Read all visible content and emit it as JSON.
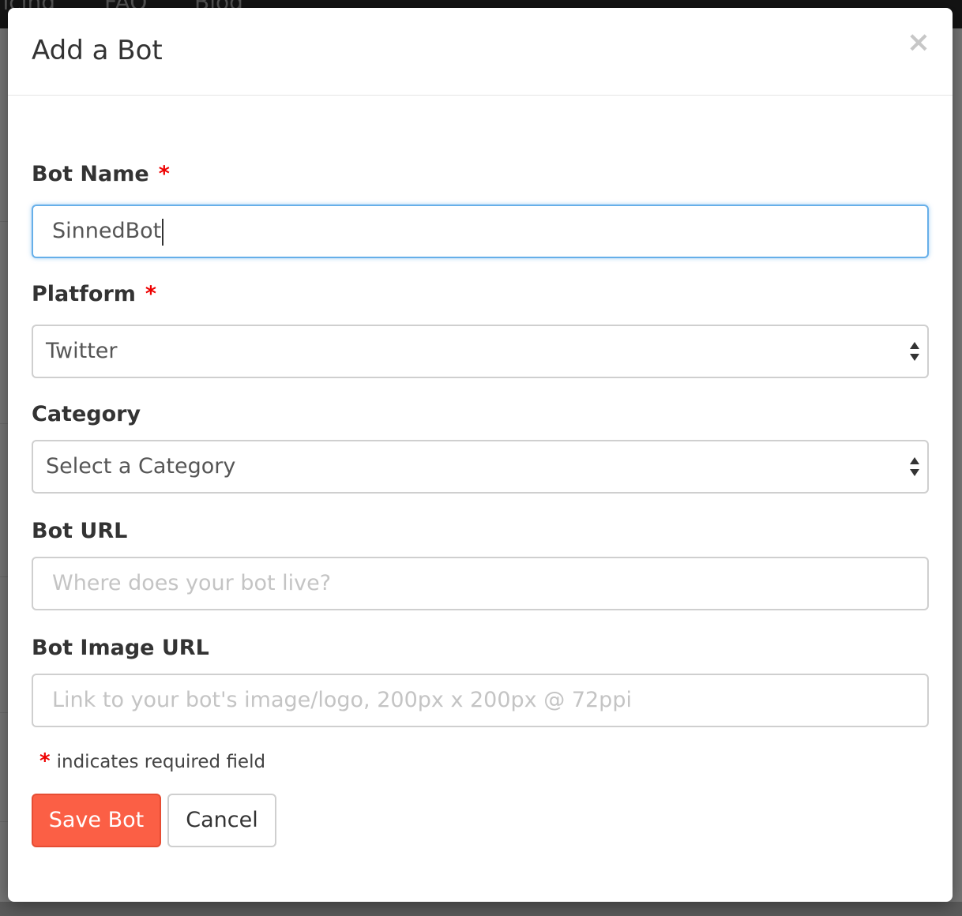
{
  "background": {
    "nav_items": [
      "ricing",
      "FAQ",
      "Blog"
    ]
  },
  "modal": {
    "title": "Add a Bot",
    "close_label": "×",
    "fields": {
      "bot_name": {
        "label": "Bot Name",
        "required_mark": "*",
        "value": "SinnedBot"
      },
      "platform": {
        "label": "Platform",
        "required_mark": "*",
        "selected": "Twitter"
      },
      "category": {
        "label": "Category",
        "selected": "Select a Category"
      },
      "bot_url": {
        "label": "Bot URL",
        "placeholder": "Where does your bot live?"
      },
      "bot_image_url": {
        "label": "Bot Image URL",
        "placeholder": "Link to your bot's image/logo, 200px x 200px @ 72ppi"
      }
    },
    "required_note": {
      "mark": "*",
      "text": "indicates required field"
    },
    "buttons": {
      "save_label": "Save Bot",
      "cancel_label": "Cancel"
    }
  },
  "colors": {
    "primary_button": "#fb5f45",
    "required_star": "#ee0000",
    "focus_border": "#66afe9"
  }
}
